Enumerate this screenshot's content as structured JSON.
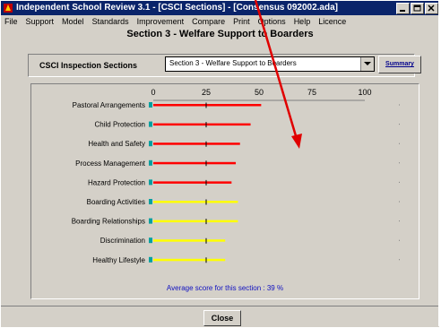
{
  "window": {
    "title": "Independent School Review 3.1 - [CSCI Sections] - [Consensus 092002.ada]"
  },
  "menu": [
    "File",
    "Support",
    "Model",
    "Standards",
    "Improvement",
    "Compare",
    "Print",
    "Options",
    "Help",
    "Licence"
  ],
  "section_title": "Section 3 -  Welfare Support to Boarders",
  "inspection": {
    "label": "CSCI Inspection Sections",
    "selected": "Section 3 - Welfare Support to Boarders",
    "summary_button": "Summary"
  },
  "chart_data": {
    "type": "bar",
    "orientation": "horizontal",
    "xlim": [
      0,
      100
    ],
    "xticks": [
      "0",
      "25",
      "50",
      "75",
      "100"
    ],
    "categories": [
      "Pastoral Arrangements",
      "Child Protection",
      "Health and Safety",
      "Process Management",
      "Hazard Protection",
      "Boarding Activities",
      "Boarding Relationships",
      "Discrimination",
      "Healthy Lifestyle"
    ],
    "values": [
      51,
      46,
      41,
      39,
      37,
      40,
      40,
      34,
      34
    ],
    "bar_colors": [
      "#ff0000",
      "#ff0000",
      "#ff0000",
      "#ff0000",
      "#ff0000",
      "#ffff00",
      "#ffff00",
      "#ffff00",
      "#ffff00"
    ],
    "average_text": "Average score for this section :  39 %"
  },
  "footer": {
    "close_button": "Close"
  },
  "annotation": {
    "arrow_color": "#e00000"
  }
}
